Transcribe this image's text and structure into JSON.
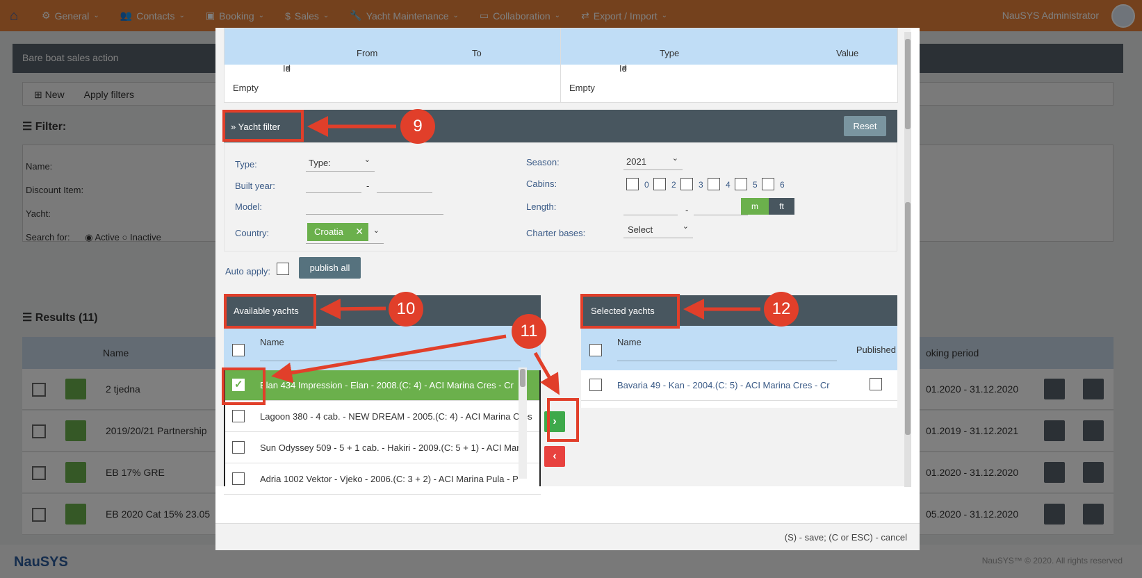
{
  "app": {
    "nav": [
      {
        "label": "General",
        "icon": "gear-icon"
      },
      {
        "label": "Contacts",
        "icon": "people-icon"
      },
      {
        "label": "Booking",
        "icon": "briefcase-icon"
      },
      {
        "label": "Sales",
        "icon": "dollar-icon"
      },
      {
        "label": "Yacht Maintenance",
        "icon": "wrench-icon"
      },
      {
        "label": "Collaboration",
        "icon": "chat-icon"
      },
      {
        "label": "Export / Import",
        "icon": "exchange-icon"
      }
    ],
    "user": "NauSYS Administrator",
    "panel_title": "Bare boat sales action",
    "toolbar": {
      "new": "New",
      "apply_filters": "Apply filters"
    },
    "filter_title": "Filter:",
    "filter_labels": [
      "Name:",
      "Discount Item:",
      "Yacht:",
      "Search for:"
    ],
    "search_for": [
      "Active",
      "Inactive"
    ],
    "results_title": "Results (11)",
    "table": {
      "col_name": "Name",
      "col_period": "oking period",
      "rows": [
        {
          "name": "2 tjedna",
          "period": "01.2020 - 31.12.2020"
        },
        {
          "name": "2019/20/21 Partnership",
          "period": "01.2019 - 31.12.2021"
        },
        {
          "name": "EB 17% GRE",
          "period": "01.2020 - 31.12.2020"
        },
        {
          "name": "EB 2020 Cat 15% 23.05",
          "period": "05.2020 - 31.12.2020"
        }
      ]
    },
    "footer_logo": "NauSYS",
    "footer_copy": "NauSYS™ © 2020. All rights reserved"
  },
  "modal": {
    "top_left_table": {
      "cols": [
        "Id",
        "From",
        "To"
      ],
      "empty": "Empty"
    },
    "top_right_table": {
      "cols": [
        "Id",
        "Type",
        "Value"
      ],
      "empty": "Empty"
    },
    "yacht_filter": {
      "title": "» Yacht filter",
      "reset": "Reset",
      "labels": {
        "type": "Type:",
        "built_year": "Built year:",
        "model": "Model:",
        "country": "Country:",
        "season": "Season:",
        "cabins": "Cabins:",
        "length": "Length:",
        "charter_bases": "Charter bases:"
      },
      "type_value": "Type:",
      "season_value": "2021",
      "country_chip": "Croatia",
      "cabins": [
        "0",
        "2",
        "3",
        "4",
        "5",
        "6"
      ],
      "length_units": [
        "m",
        "ft"
      ],
      "charter_bases_value": "Select",
      "range_sep": "-"
    },
    "auto_apply": "Auto apply:",
    "publish_all": "publish all",
    "available": {
      "title": "Available yachts",
      "col_name": "Name",
      "rows": [
        "Elan 434 Impression - Elan - 2008.(C: 4) - ACI Marina Cres - Cr",
        "Lagoon 380 - 4 cab. - NEW DREAM - 2005.(C: 4) - ACI Marina Cres",
        "Sun Odyssey 509 - 5 + 1 cab. - Hakiri - 2009.(C: 5 + 1) - ACI Marin",
        "Adria 1002 Vektor - Vjeko - 2006.(C: 3 + 2) - ACI Marina Pula - P"
      ]
    },
    "selected": {
      "title": "Selected yachts",
      "col_name": "Name",
      "col_published": "Published",
      "rows": [
        "Bavaria 49 - Kan - 2004.(C: 5) - ACI Marina Cres - Cr"
      ]
    },
    "move_right": "›",
    "move_left": "‹",
    "footer_hint": "(S) - save; (C or ESC) - cancel"
  },
  "annotations": [
    "9",
    "10",
    "11",
    "12"
  ],
  "colors": {
    "accent_orange": "#e8833b",
    "annotation_red": "#e13f2a",
    "green": "#6bb04c",
    "header_dark": "#48565f"
  }
}
